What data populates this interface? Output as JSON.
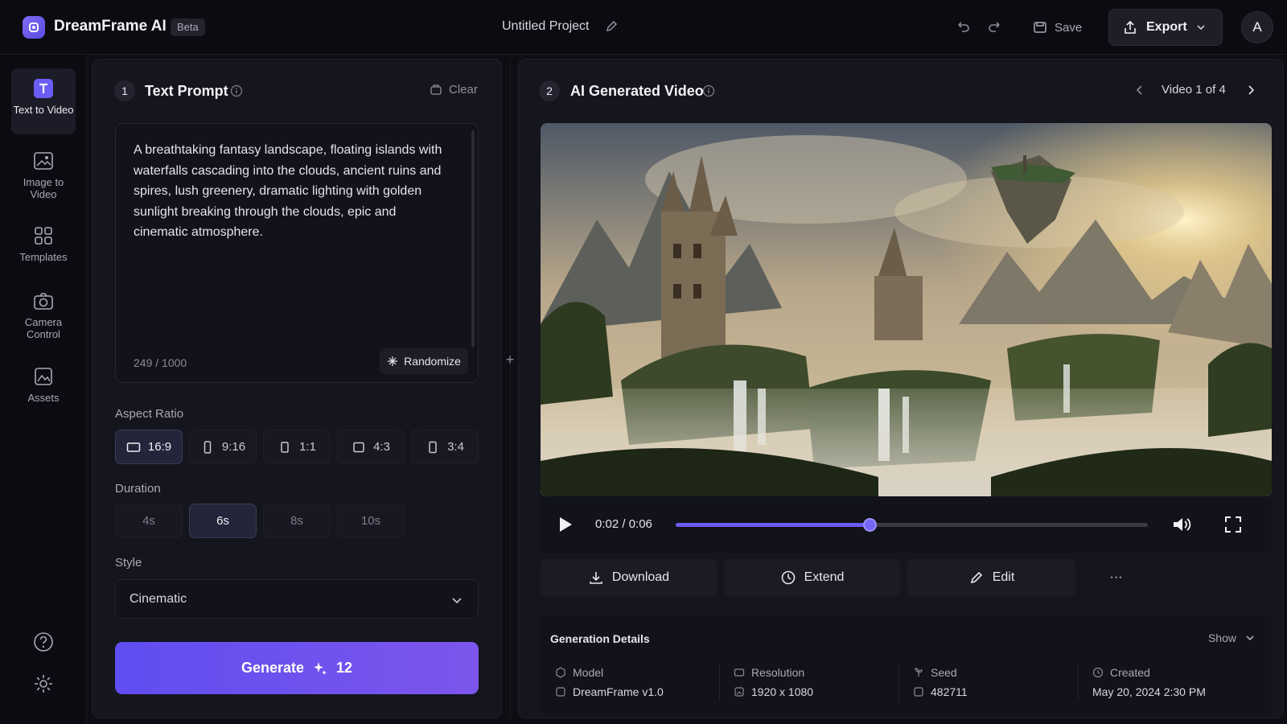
{
  "header": {
    "app_title": "DreamFrame AI",
    "beta_badge": "Beta",
    "project_title": "Untitled Project",
    "save_label": "Save",
    "export_label": "Export",
    "avatar_initial": "A"
  },
  "sidebar": {
    "items": [
      {
        "label": "Text to Video",
        "icon": "text-icon"
      },
      {
        "label": "Image to Video",
        "icon": "image-icon"
      },
      {
        "label": "Templates",
        "icon": "grid-icon"
      },
      {
        "label": "Camera Control",
        "icon": "camera-icon"
      },
      {
        "label": "Assets",
        "icon": "assets-icon"
      }
    ]
  },
  "prompt_panel": {
    "step": "1",
    "title": "Text Prompt",
    "clear_label": "Clear",
    "prompt_text": "A breathtaking fantasy landscape, floating islands with waterfalls cascading into the clouds, ancient ruins and spires, lush greenery, dramatic lighting with golden sunlight breaking through the clouds, epic and cinematic atmosphere.",
    "char_count": "249 / 1000",
    "randomize_label": "Randomize",
    "aspect_label": "Aspect Ratio",
    "aspect_options": [
      "16:9",
      "9:16",
      "1:1",
      "4:3",
      "3:4"
    ],
    "aspect_selected": "16:9",
    "duration_label": "Duration",
    "duration_options": [
      "4s",
      "6s",
      "8s",
      "10s"
    ],
    "duration_selected": "6s",
    "style_label": "Style",
    "style_value": "Cinematic",
    "generate_label": "Generate",
    "generate_cost": "12"
  },
  "video_panel": {
    "step": "2",
    "title": "AI Generated Video",
    "nav_label": "Video 1 of 4",
    "time_label": "0:02 / 0:06",
    "progress_fraction": 0.41,
    "actions": {
      "download": "Download",
      "extend": "Extend",
      "edit": "Edit",
      "more": "···"
    },
    "details": {
      "title": "Generation Details",
      "show_label": "Show",
      "model_label": "Model",
      "model_value": "DreamFrame v1.0",
      "resolution_label": "Resolution",
      "resolution_value": "1920 x 1080",
      "seed_label": "Seed",
      "seed_value": "482711",
      "created_label": "Created",
      "created_value": "May 20, 2024 2:30 PM"
    }
  },
  "colors": {
    "accent": "#6a5cf4",
    "background": "#0d0d14",
    "panel": "#15151e"
  }
}
